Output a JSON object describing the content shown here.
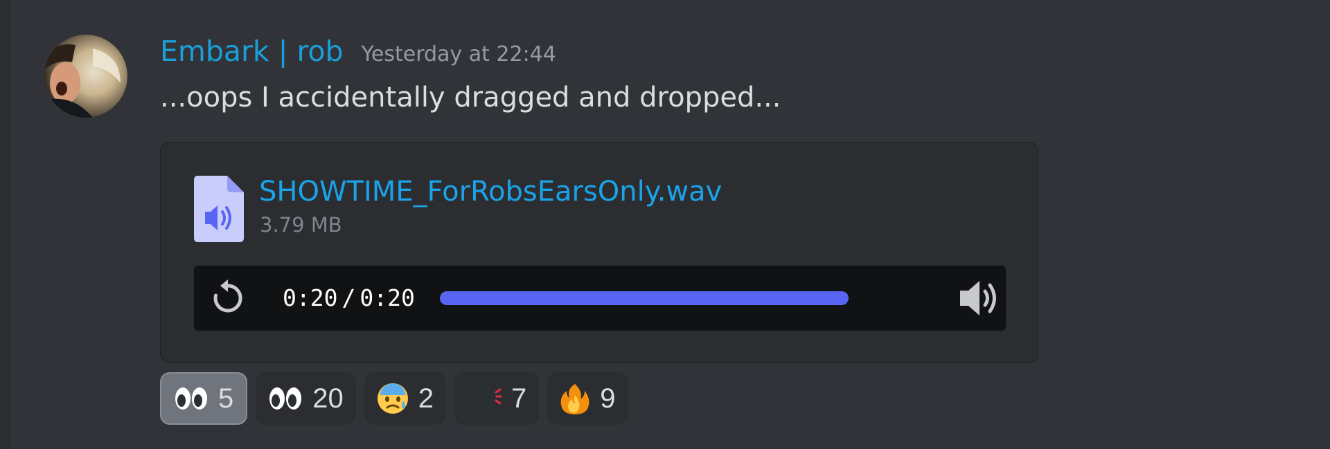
{
  "message": {
    "username": "Embark | rob",
    "timestamp": "Yesterday at 22:44",
    "content": "...oops I accidentally dragged and dropped...",
    "avatar_icon": "user-avatar"
  },
  "attachment": {
    "file_name": "SHOWTIME_ForRobsEarsOnly.wav",
    "file_size": "3.79 MB",
    "file_icon": "audio-file-icon",
    "player": {
      "current_time": "0:20",
      "separator": "/",
      "duration": "0:20",
      "progress": 1.0,
      "replay_icon": "replay-icon",
      "volume_icon": "volume-icon"
    }
  },
  "reactions": [
    {
      "emoji_icon": "eyes-emoji",
      "count": "5",
      "active": true
    },
    {
      "emoji_icon": "eyes-emoji",
      "count": "20",
      "active": false
    },
    {
      "emoji_icon": "anxious-face-emoji",
      "count": "2",
      "active": false
    },
    {
      "emoji_icon": "speaking-head-emoji",
      "count": "7",
      "active": false
    },
    {
      "emoji_icon": "fire-emoji",
      "count": "9",
      "active": false
    }
  ],
  "colors": {
    "background": "#313338",
    "username": "#1a9fd8",
    "link": "#1aa3e8",
    "progress_fill": "#5865f2",
    "attachment_bg": "#2b2d31",
    "player_bg": "#111214"
  }
}
